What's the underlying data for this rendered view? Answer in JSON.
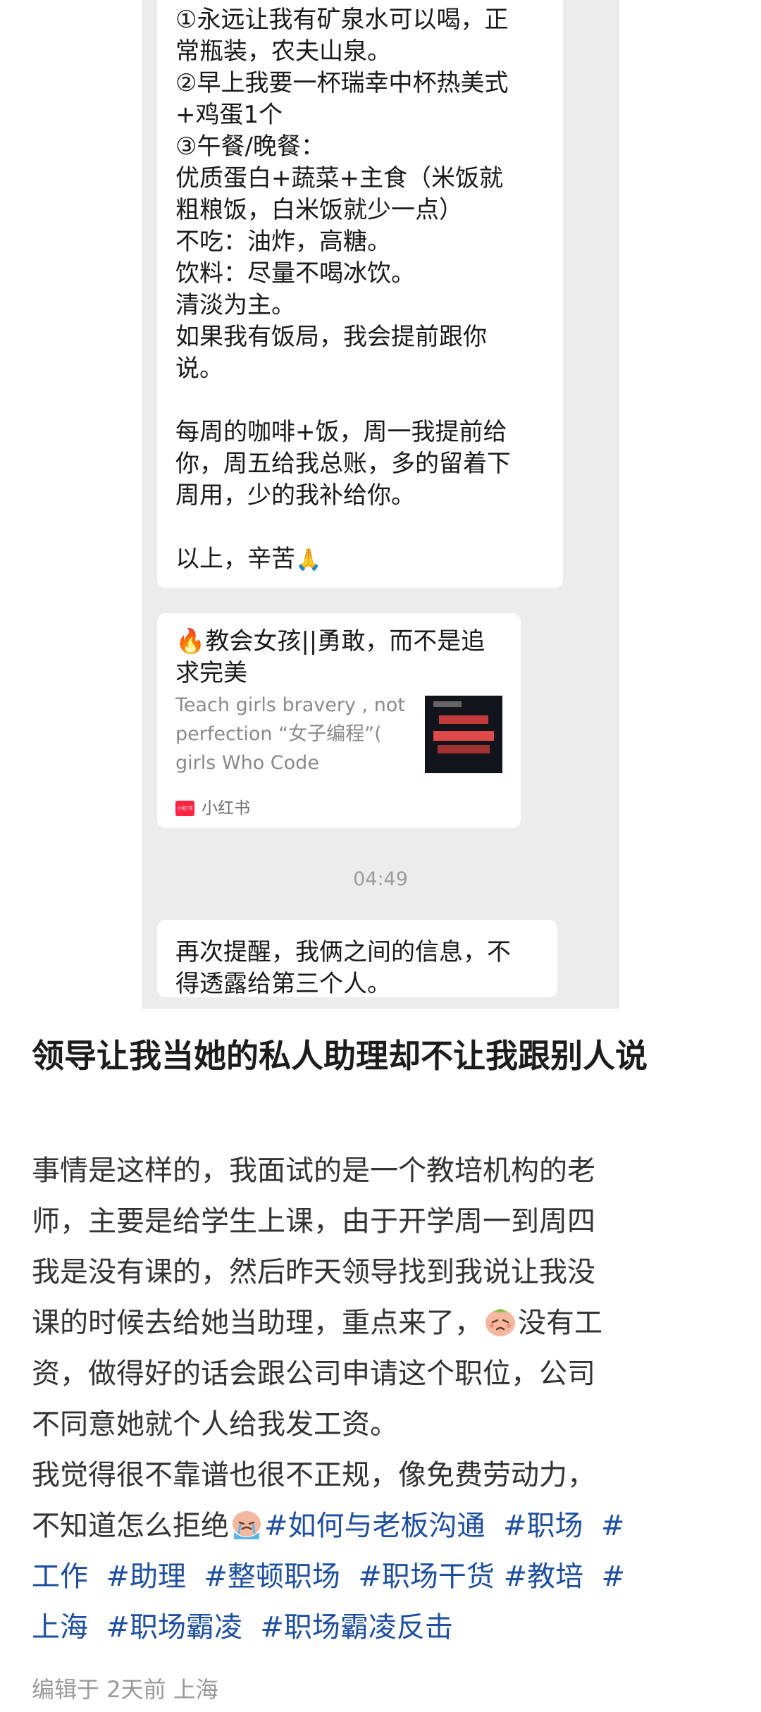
{
  "chat": {
    "message_lines": [
      "①永远让我有矿泉水可以喝，正",
      "常瓶装，农夫山泉。",
      "②早上我要一杯瑞幸中杯热美式",
      "+鸡蛋1个",
      "③午餐/晚餐：",
      "优质蛋白+蔬菜+主食（米饭就",
      "粗粮饭，白米饭就少一点）",
      "不吃：油炸，高糖。",
      "饮料：尽量不喝冰饮。",
      "清淡为主。",
      "如果我有饭局，我会提前跟你",
      "说。",
      "",
      "每周的咖啡+饭，周一我提前给",
      "你，周五给我总账，多的留着下",
      "周用，少的我补给你。",
      "",
      "以上，辛苦"
    ],
    "pray_emoji": "🙏",
    "card": {
      "title": "🔥教会女孩||勇敢，而不是追求完美",
      "desc": "Teach girls bravery , not perfection “女子编程”( girls Who Code",
      "source_icon_text": "小红书",
      "source": "小红书"
    },
    "timestamp": "04:49",
    "last_message": [
      "再次提醒，我俩之间的信息，不",
      "得透露给第三个人。"
    ]
  },
  "post": {
    "title": "领导让我当她的私人助理却不让我跟别人说",
    "body_lines": [
      "事情是这样的，我面试的是一个教培机构的老",
      "师，主要是给学生上课，由于开学周一到周四",
      "我是没有课的，然后昨天领导找到我说让我没",
      "课的时候去给她当助理，重点来了，"
    ],
    "body_line4_tail": "没有工",
    "body_lines2": [
      "资，做得好的话会跟公司申请这个职位，公司",
      "不同意她就个人给我发工资。",
      "我觉得很不靠谱也很不正规，像免费劳动力，"
    ],
    "body_last_prefix": "不知道怎么拒绝",
    "tags": [
      "#如何与老板沟通",
      "#职场",
      "#工作",
      "#助理",
      "#整顿职场",
      "#职场干货",
      "#教培",
      "#上海",
      "#职场霸凌",
      "#职场霸凌反击"
    ],
    "meta": "编辑于 2天前 上海",
    "emoji_names": [
      "sad-face-icon",
      "crying-face-icon"
    ]
  },
  "colors": {
    "tag": "#1e4fa0",
    "chat_bg": "#ececec",
    "xhs_red": "#ff2442"
  }
}
